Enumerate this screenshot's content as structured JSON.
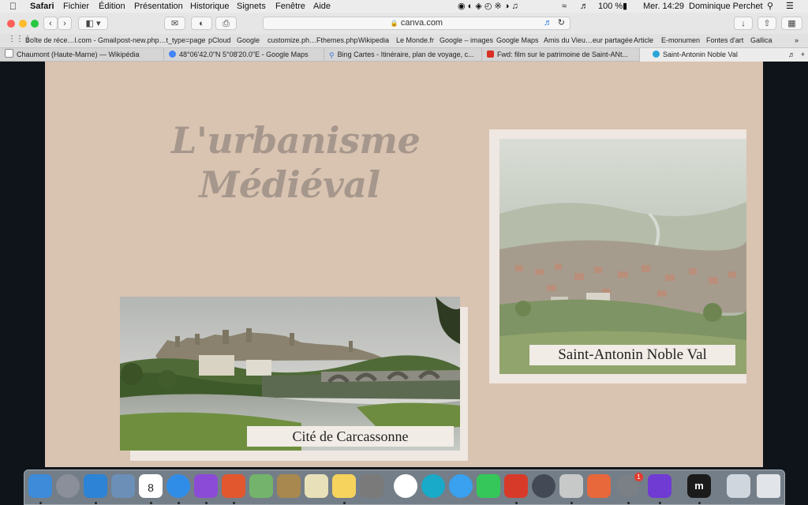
{
  "menubar": {
    "app": "Safari",
    "items": [
      "Fichier",
      "Édition",
      "Présentation",
      "Historique",
      "Signets",
      "Fenêtre",
      "Aide"
    ],
    "battery": "100 %",
    "clock": "Mer. 14:29",
    "user": "Dominique Perchet"
  },
  "toolbar": {
    "address": "canva.com"
  },
  "bookmarks": [
    "Boîte de réce…l.com - Gmail",
    "post-new.php…t_type=page",
    "pCloud",
    "Google",
    "customize.ph…Fthemes.php",
    "Wikipedia",
    "Le Monde.fr",
    "Google – images",
    "Google Maps",
    "Amis du Vieu…eur partagée",
    "Article",
    "E-monumen",
    "Fontes d'art",
    "Gallica"
  ],
  "tabs": [
    {
      "title": "Chaumont (Haute-Marne) — Wikipédia",
      "icon": "wikipedia-icon"
    },
    {
      "title": "48°06'42.0\"N 5°08'20.0\"E - Google Maps",
      "icon": "google-icon"
    },
    {
      "title": "Bing Cartes - Itinéraire, plan de voyage, c...",
      "icon": "bing-search-icon"
    },
    {
      "title": "Fwd: film sur le patrimoine de Saint-ANt...",
      "icon": "gmail-icon"
    },
    {
      "title": "Saint-Antonin Noble Val",
      "icon": "canva-icon",
      "active": true
    }
  ],
  "slide": {
    "title_line1": "L'urbanisme",
    "title_line2": "Médiéval",
    "caption_left": "Cité de Carcassonne",
    "caption_right": "Saint-Antonin Noble Val"
  },
  "colors": {
    "slide_bg": "#d9c3b1",
    "title": "#a6978c",
    "frame": "#efe7e1",
    "caption_bg": "#f1ece6"
  },
  "dock": [
    "finder-icon",
    "launchpad-icon",
    "mail-icon",
    "preview-icon",
    "calendar-icon",
    "safari-icon",
    "affinity-designer-icon",
    "affinity-publisher-icon",
    "maps-icon",
    "script-icon",
    "notes-icon",
    "textedit-icon",
    "photos-icon",
    "pcloud-icon",
    "messages-icon",
    "facetime-icon",
    "pdf-icon",
    "color-icon",
    "image-capture-icon",
    "affinity-photo-icon",
    "system-preferences-icon",
    "imovie-icon",
    "m-app-icon",
    "downloads-folder-icon",
    "trash-icon"
  ],
  "calendar_day": "8",
  "prefs_badge": "1"
}
